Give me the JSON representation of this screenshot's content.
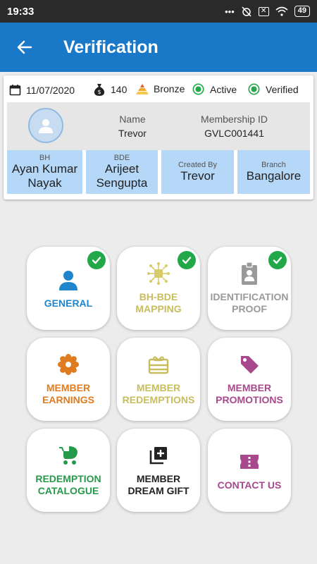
{
  "status_bar": {
    "time": "19:33",
    "dots": "•••",
    "battery": "49"
  },
  "header": {
    "title": "Verification"
  },
  "summary": {
    "date": "11/07/2020",
    "points": "140",
    "tier": "Bronze",
    "status1": "Active",
    "status2": "Verified",
    "name_label": "Name",
    "name_value": "Trevor",
    "membership_label": "Membership ID",
    "membership_value": "GVLC001441",
    "boxes": [
      {
        "label": "BH",
        "value": "Ayan Kumar Nayak"
      },
      {
        "label": "BDE",
        "value": "Arijeet Sengupta"
      },
      {
        "label": "Created By",
        "value": "Trevor"
      },
      {
        "label": "Branch",
        "value": "Bangalore"
      }
    ]
  },
  "tiles": [
    {
      "label": "GENERAL",
      "color": "#1f86cc",
      "checked": true
    },
    {
      "label": "BH-BDE\nMAPPING",
      "color": "#c8bd5e",
      "checked": true
    },
    {
      "label": "IDENTIFICATION\nPROOF",
      "color": "#9a9a9a",
      "checked": true
    },
    {
      "label": "MEMBER\nEARNINGS",
      "color": "#e07b1f",
      "checked": false
    },
    {
      "label": "MEMBER\nREDEMPTIONS",
      "color": "#c8bd5e",
      "checked": false
    },
    {
      "label": "MEMBER\nPROMOTIONS",
      "color": "#a8498d",
      "checked": false
    },
    {
      "label": "REDEMPTION\nCATALOGUE",
      "color": "#27994a",
      "checked": false
    },
    {
      "label": "MEMBER\nDREAM GIFT",
      "color": "#222222",
      "checked": false
    },
    {
      "label": "CONTACT US",
      "color": "#a8498d",
      "checked": false
    }
  ]
}
